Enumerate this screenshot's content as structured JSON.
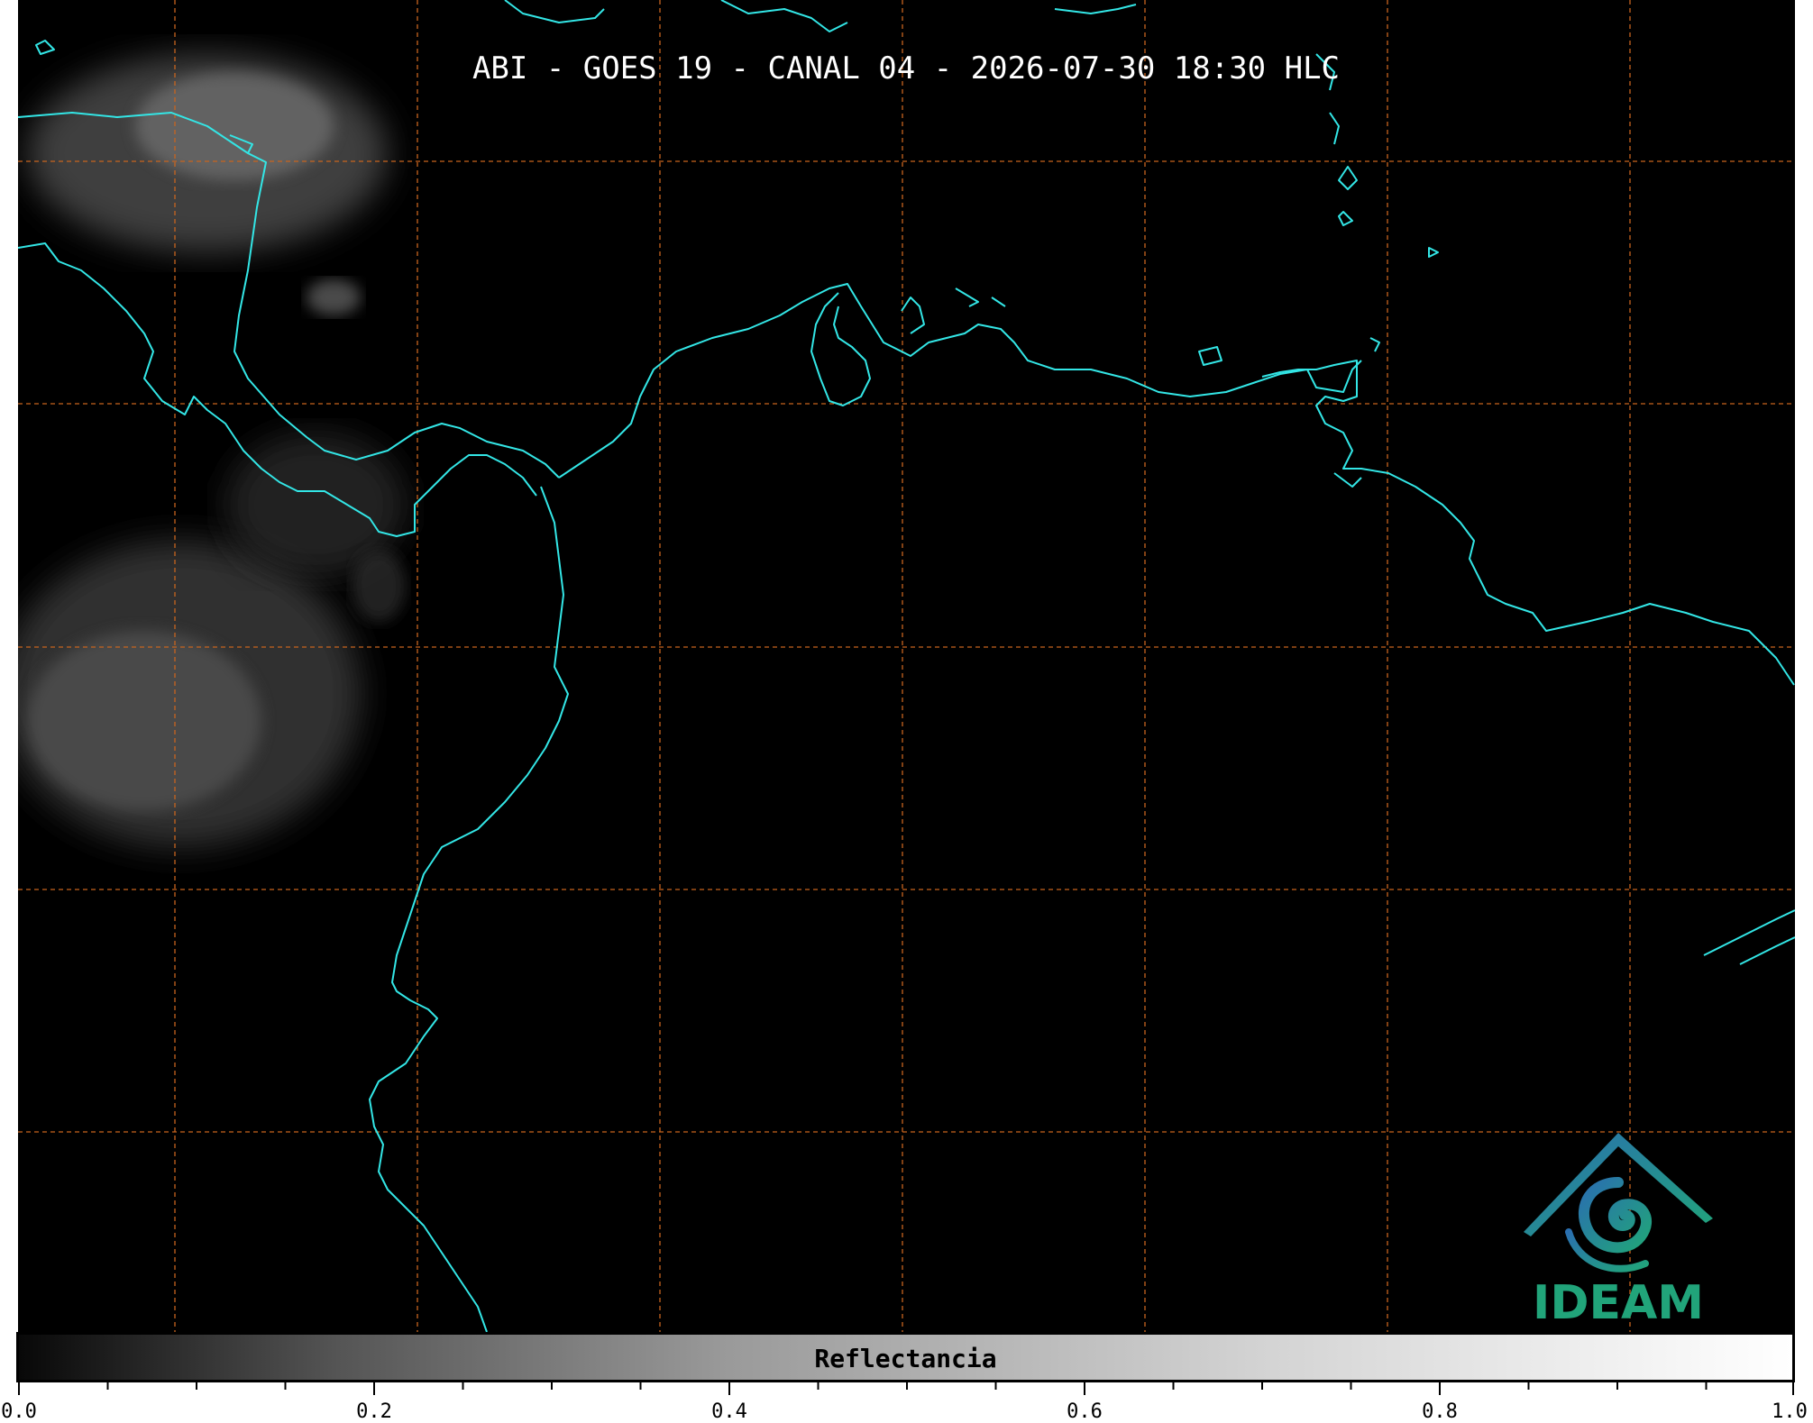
{
  "title": "ABI - GOES 19 - CANAL 04 - 2026-07-30 18:30 HLC",
  "map": {
    "background_color": "#000000",
    "coastline_color": "#33e6e6",
    "gridline_color": "#c8641e",
    "gridline_style": "dashed"
  },
  "logo": {
    "text": "IDEAM",
    "text_color": "#21a47a",
    "colors": [
      "#2a6fb0",
      "#21a47a"
    ]
  },
  "colorbar": {
    "label": "Reflectancia",
    "range": [
      0.0,
      1.0
    ],
    "tick_labels": [
      "0.0",
      "0.2",
      "0.4",
      "0.6",
      "0.8",
      "1.0"
    ],
    "colormap": "grayscale"
  }
}
